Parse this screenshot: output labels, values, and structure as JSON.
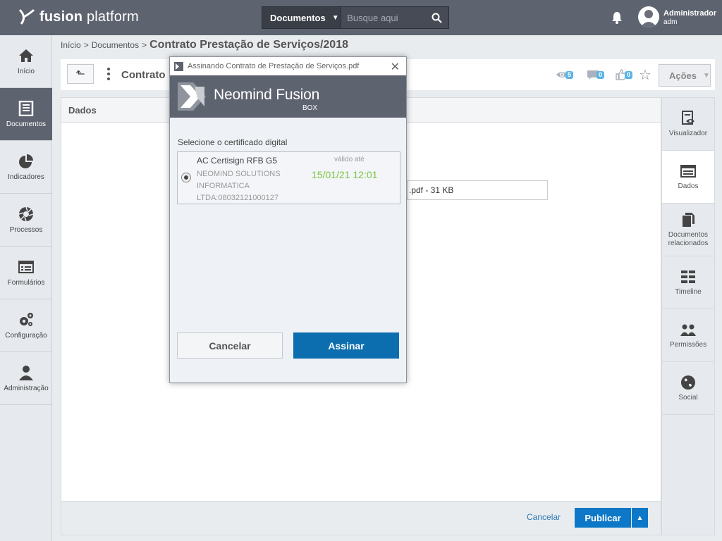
{
  "header": {
    "brand_bold": "fusion",
    "brand_light": " platform",
    "search_category": "Documentos",
    "search_placeholder": "Busque aqui",
    "user_name": "Administrador",
    "user_login": "adm"
  },
  "sidebar": {
    "items": [
      {
        "label": "Início",
        "icon": "home-icon"
      },
      {
        "label": "Documentos",
        "icon": "document-icon"
      },
      {
        "label": "Indicadores",
        "icon": "pie-chart-icon"
      },
      {
        "label": "Processos",
        "icon": "aperture-icon"
      },
      {
        "label": "Formulários",
        "icon": "form-icon"
      },
      {
        "label": "Configuração",
        "icon": "gears-icon"
      },
      {
        "label": "Administração",
        "icon": "user-icon"
      }
    ]
  },
  "breadcrumb": {
    "home": "Início",
    "section": "Documentos",
    "current": "Contrato Prestação de Serviços/2018"
  },
  "toolbar": {
    "title": "Contrato",
    "views": "5",
    "comments": "0",
    "likes": "0",
    "actions_label": "Ações"
  },
  "main": {
    "panel_title": "Dados",
    "file_text": ".pdf  - 31 KB",
    "cancel_link": "Cancelar",
    "publish_label": "Publicar"
  },
  "rightnav": {
    "items": [
      {
        "label": "Visualizador",
        "icon": "viewer-icon"
      },
      {
        "label": "Dados",
        "icon": "data-icon"
      },
      {
        "label": "Documentos relacionados",
        "icon": "related-docs-icon"
      },
      {
        "label": "Timeline",
        "icon": "timeline-icon"
      },
      {
        "label": "Permissões",
        "icon": "permissions-icon"
      },
      {
        "label": "Social",
        "icon": "globe-icon"
      }
    ]
  },
  "dialog": {
    "title": "Assinando Contrato de Prestação de Serviços.pdf",
    "banner_title": "Neomind Fusion",
    "banner_sub": "BOX",
    "select_label": "Selecione o certificado digital",
    "cert_name": "AC Certisign RFB G5",
    "cert_org": "NEOMIND SOLUTIONS INFORMATICA LTDA:08032121000127",
    "valid_label": "válido até",
    "valid_date": "15/01/21 12:01",
    "cancel_label": "Cancelar",
    "sign_label": "Assinar"
  },
  "colors": {
    "topbar": "#5e6370",
    "primary_blue": "#0d78c7",
    "valid_green": "#7cc442",
    "badge_blue": "#5ab4e5"
  }
}
